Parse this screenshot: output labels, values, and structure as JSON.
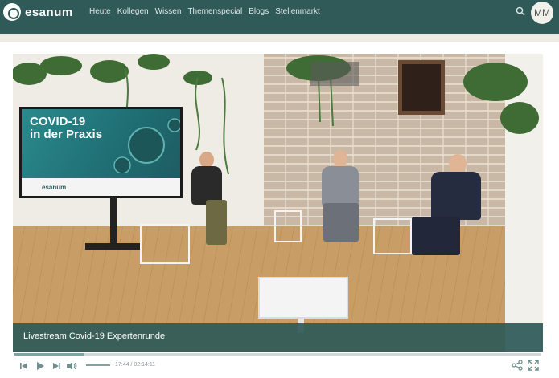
{
  "brand": {
    "name": "esanum"
  },
  "nav": {
    "items": [
      {
        "label": "Heute"
      },
      {
        "label": "Kollegen"
      },
      {
        "label": "Wissen"
      },
      {
        "label": "Themenspecial"
      },
      {
        "label": "Blogs"
      },
      {
        "label": "Stellenmarkt"
      }
    ]
  },
  "user": {
    "initials": "MM"
  },
  "video": {
    "screen_title_line1": "COVID-19",
    "screen_title_line2": "in der Praxis",
    "screen_logo": "esanum",
    "caption": "Livestream Covid-19 Expertenrunde",
    "time": "17:44 / 02:14:11",
    "progress": 0.132,
    "volume": 1.0
  },
  "icons": {
    "search": "search-icon",
    "prev": "skip-back-icon",
    "play": "play-icon",
    "next": "skip-forward-icon",
    "volume": "volume-icon",
    "share": "share-icon",
    "fullscreen": "fullscreen-icon"
  },
  "colors": {
    "brand": "#2f5a58",
    "accent": "#7aa7a4",
    "background": "#ecebe6"
  }
}
